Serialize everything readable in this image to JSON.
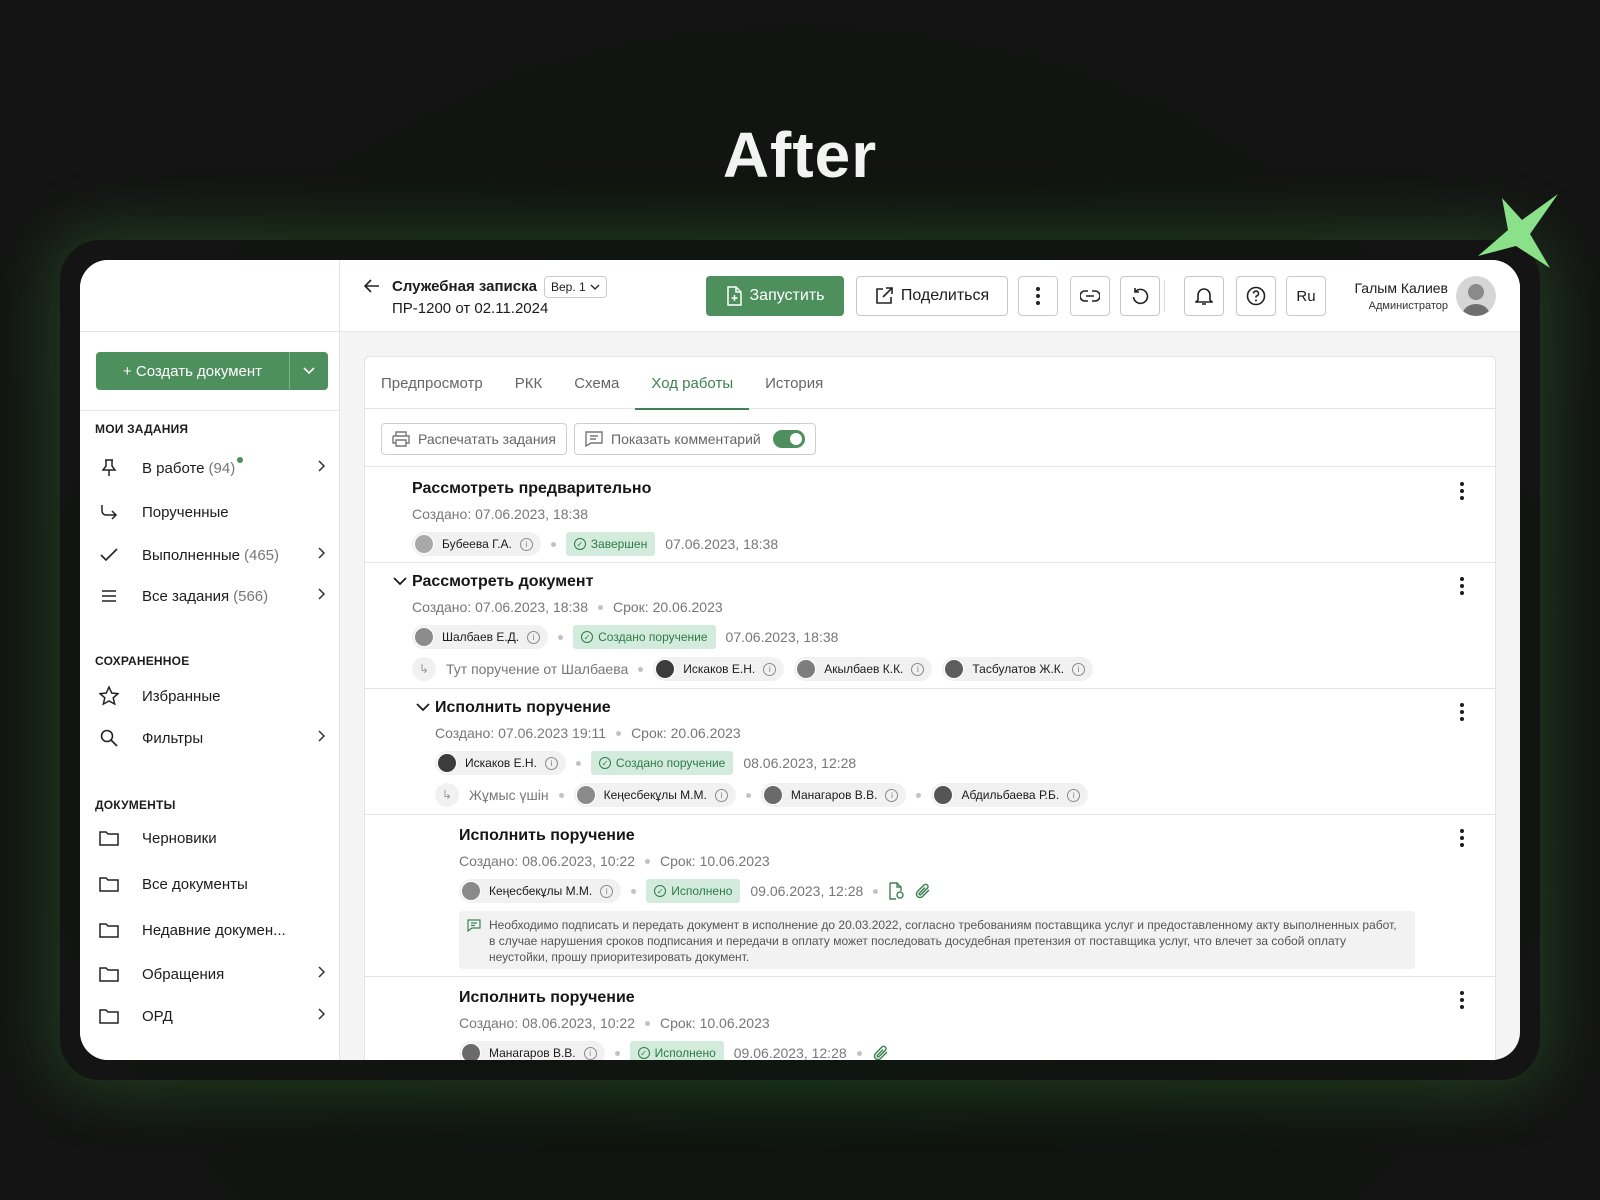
{
  "headline": "After",
  "sidebar": {
    "create_label": "+ Создать документ",
    "section_tasks": "МОИ ЗАДАНИЯ",
    "section_saved": "СОХРАНЕННОЕ",
    "section_docs": "ДОКУМЕНТЫ",
    "items": [
      {
        "label": "В работе",
        "count": "(94)",
        "icon": "pin-icon"
      },
      {
        "label": "Порученные",
        "count": "",
        "icon": "forward-arrow-icon"
      },
      {
        "label": "Выполненные",
        "count": "(465)",
        "icon": "check-icon"
      },
      {
        "label": "Все задания",
        "count": "(566)",
        "icon": "list-icon"
      },
      {
        "label": "Избранные",
        "count": "",
        "icon": "star-icon"
      },
      {
        "label": "Фильтры",
        "count": "",
        "icon": "search-icon"
      },
      {
        "label": "Черновики",
        "count": "",
        "icon": "folder-icon"
      },
      {
        "label": "Все документы",
        "count": "",
        "icon": "folder-icon"
      },
      {
        "label": "Недавние докумен...",
        "count": "",
        "icon": "folder-icon"
      },
      {
        "label": "Обращения",
        "count": "",
        "icon": "folder-icon"
      },
      {
        "label": "ОРД",
        "count": "",
        "icon": "folder-icon"
      }
    ]
  },
  "header": {
    "title": "Служебная записка",
    "version": "Вер. 1",
    "subtitle": "ПР-1200 от 02.11.2024",
    "run_label": "Запустить",
    "share_label": "Поделиться",
    "lang": "Ru",
    "user_name": "Галым Калиев",
    "user_role": "Администратор"
  },
  "tabs": [
    "Предпросмотр",
    "РКК",
    "Схема",
    "Ход работы",
    "История"
  ],
  "active_tab": "Ход работы",
  "toolbar": {
    "print_label": "Распечатать задания",
    "comments_label": "Показать комментарий",
    "comments_on": true
  },
  "tasks": [
    {
      "title": "Рассмотреть предварительно",
      "created": "Создано: 07.06.2023, 18:38",
      "due": "",
      "assignee": "Бубеева Г.А.",
      "status": "Завершен",
      "status_time": "07.06.2023, 18:38"
    },
    {
      "title": "Рассмотреть документ",
      "created": "Создано: 07.06.2023, 18:38",
      "due": "Срок: 20.06.2023",
      "assignee": "Шалбаев Е.Д.",
      "status": "Создано поручение",
      "status_time": "07.06.2023, 18:38",
      "delegation_note": "Тут поручение от Шалбаева",
      "delegates": [
        "Искаков Е.Н.",
        "Акылбаев К.К.",
        "Тасбулатов Ж.К."
      ]
    },
    {
      "title": "Исполнить поручение",
      "created": "Создано: 07.06.2023 19:11",
      "due": "Срок: 20.06.2023",
      "assignee": "Искаков Е.Н.",
      "status": "Создано поручение",
      "status_time": "08.06.2023, 12:28",
      "delegation_note": "Жұмыс үшін",
      "delegates": [
        "Кеңесбекұлы М.М.",
        "Манагаров В.В.",
        "Абдильбаева Р.Б."
      ]
    },
    {
      "title": "Исполнить поручение",
      "created": "Создано: 08.06.2023, 10:22",
      "due": "Срок: 10.06.2023",
      "assignee": "Кеңесбекұлы М.М.",
      "status": "Исполнено",
      "status_time": "09.06.2023, 12:28",
      "comment": "Необходимо подписать и передать документ в исполнение до 20.03.2022, согласно требованиям поставщика услуг и предоставленному акту выполненных работ, в случае нарушения сроков подписания и передачи в оплату может последовать досудебная претензия от поставщика услуг, что влечет за собой оплату неустойки, прошу приоритезировать документ."
    },
    {
      "title": "Исполнить поручение",
      "created": "Создано: 08.06.2023, 10:22",
      "due": "Срок: 10.06.2023",
      "assignee": "Манагаров В.В.",
      "status": "Исполнено",
      "status_time": "09.06.2023, 12:28"
    }
  ],
  "colors": {
    "accent": "#4e8f5e",
    "status_bg": "#d3ebdc",
    "background": "#141414"
  }
}
